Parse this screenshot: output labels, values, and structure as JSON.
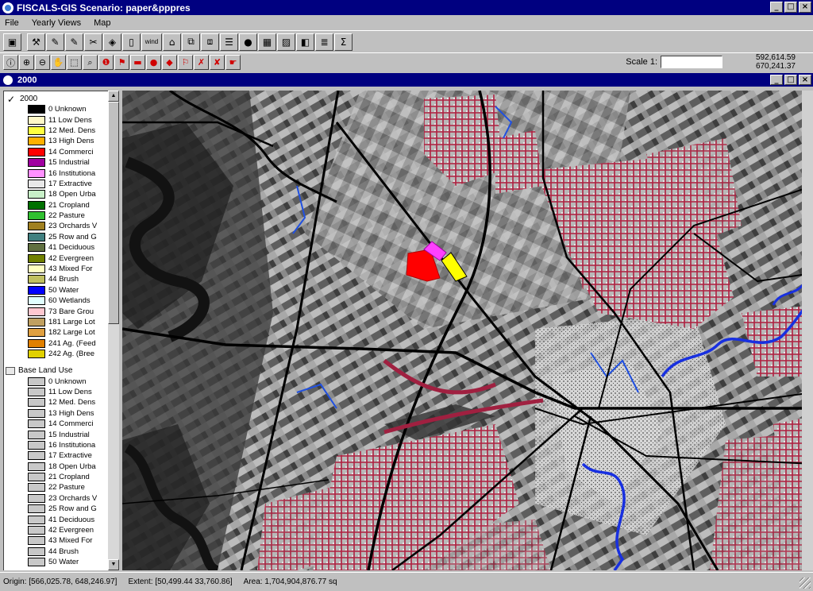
{
  "window": {
    "title": "FISCALS-GIS  Scenario: paper&pppres",
    "min": "_",
    "max": "□",
    "close": "×"
  },
  "menu": [
    "File",
    "Yearly Views",
    "Map"
  ],
  "toolbar1": [
    {
      "name": "save-icon",
      "glyph": "▣"
    },
    {
      "name": "hammer-icon",
      "glyph": "⚒"
    },
    {
      "name": "edit-down-icon",
      "glyph": "✎"
    },
    {
      "name": "edit-up-icon",
      "glyph": "✎"
    },
    {
      "name": "ruler-icon",
      "glyph": "✂"
    },
    {
      "name": "back-icon",
      "glyph": "◈"
    },
    {
      "name": "page-icon",
      "glyph": "▯"
    },
    {
      "name": "wind-icon",
      "glyph": "wind",
      "wide": true
    },
    {
      "name": "open-folder-icon",
      "glyph": "⌂"
    },
    {
      "name": "copy-icon",
      "glyph": "⧉"
    },
    {
      "name": "paste-icon",
      "glyph": "⧈"
    },
    {
      "name": "list-icon",
      "glyph": "☰"
    },
    {
      "name": "blob-icon",
      "glyph": "●"
    },
    {
      "name": "grid-icon",
      "glyph": "▦"
    },
    {
      "name": "hatch-icon",
      "glyph": "▨"
    },
    {
      "name": "shape-icon",
      "glyph": "◧"
    },
    {
      "name": "stack-icon",
      "glyph": "≣"
    },
    {
      "name": "sum-icon",
      "glyph": "Σ"
    }
  ],
  "toolbar2": [
    {
      "name": "info-icon",
      "glyph": "ⓘ"
    },
    {
      "name": "zoom-in-icon",
      "glyph": "⊕"
    },
    {
      "name": "zoom-out-icon",
      "glyph": "⊖"
    },
    {
      "name": "pan-hand-icon",
      "glyph": "✋"
    },
    {
      "name": "select-box-icon",
      "glyph": "⬚"
    },
    {
      "name": "zoom-select-icon",
      "glyph": "⌕"
    },
    {
      "name": "alert-icon",
      "glyph": "❶",
      "red": true
    },
    {
      "name": "flag-icon",
      "glyph": "⚑",
      "red": true
    },
    {
      "name": "rectangle-icon",
      "glyph": "▬",
      "red": true
    },
    {
      "name": "circle-icon",
      "glyph": "●",
      "red": true
    },
    {
      "name": "polygon-icon",
      "glyph": "◆",
      "red": true
    },
    {
      "name": "flag-edit-icon",
      "glyph": "⚐",
      "red": true
    },
    {
      "name": "delete-icon",
      "glyph": "✗",
      "red": true
    },
    {
      "name": "delete-all-icon",
      "glyph": "✘",
      "red": true
    },
    {
      "name": "hand-point-icon",
      "glyph": "☛",
      "red": true
    }
  ],
  "scale": {
    "label": "Scale 1:",
    "value": ""
  },
  "coords": {
    "x": "592,614.59",
    "y": "670,241.37"
  },
  "child": {
    "title": "2000",
    "min": "_",
    "max": "□",
    "close": "×"
  },
  "legend": {
    "group1": {
      "title": "2000",
      "check": "✓"
    },
    "items1": [
      {
        "label": "0 Unknown",
        "color": "#000000"
      },
      {
        "label": "11 Low Dens",
        "color": "#fff8c8"
      },
      {
        "label": "12 Med. Dens",
        "color": "#ffff40"
      },
      {
        "label": "13 High Dens",
        "color": "#ffb000"
      },
      {
        "label": "14 Commerci",
        "color": "#ff0000"
      },
      {
        "label": "15 Industrial",
        "color": "#a000a0"
      },
      {
        "label": "16 Institutiona",
        "color": "#ff90ff"
      },
      {
        "label": "17 Extractive",
        "color": "#e8e8e8"
      },
      {
        "label": "18 Open Urba",
        "color": "#c8f0c8"
      },
      {
        "label": "21 Cropland",
        "color": "#007000"
      },
      {
        "label": "22 Pasture",
        "color": "#30c030"
      },
      {
        "label": "23 Orchards V",
        "color": "#a08020"
      },
      {
        "label": "25 Row and G",
        "color": "#408080"
      },
      {
        "label": "41 Deciduous",
        "color": "#607040"
      },
      {
        "label": "42 Evergreen",
        "color": "#708000"
      },
      {
        "label": "43 Mixed For",
        "color": "#ffffc0"
      },
      {
        "label": "44 Brush",
        "color": "#c0c060"
      },
      {
        "label": "50 Water",
        "color": "#0000ff"
      },
      {
        "label": "60 Wetlands",
        "color": "#e0ffff"
      },
      {
        "label": "73 Bare Grou",
        "color": "#ffc8d0"
      },
      {
        "label": "181 Large Lot",
        "color": "#c0a060"
      },
      {
        "label": "182 Large Lot",
        "color": "#e0a040"
      },
      {
        "label": "241 Ag. (Feed",
        "color": "#e08000"
      },
      {
        "label": "242 Ag. (Bree",
        "color": "#e0d000"
      }
    ],
    "group2": {
      "title": "Base Land Use"
    },
    "items2": [
      {
        "label": "0 Unknown"
      },
      {
        "label": "11 Low Dens"
      },
      {
        "label": "12 Med. Dens"
      },
      {
        "label": "13 High Dens"
      },
      {
        "label": "14 Commerci"
      },
      {
        "label": "15 Industrial"
      },
      {
        "label": "16 Institutiona"
      },
      {
        "label": "17 Extractive"
      },
      {
        "label": "18 Open Urba"
      },
      {
        "label": "21 Cropland"
      },
      {
        "label": "22 Pasture"
      },
      {
        "label": "23 Orchards V"
      },
      {
        "label": "25 Row and G"
      },
      {
        "label": "41 Deciduous"
      },
      {
        "label": "42 Evergreen"
      },
      {
        "label": "43 Mixed For"
      },
      {
        "label": "44 Brush"
      },
      {
        "label": "50 Water"
      }
    ]
  },
  "status": {
    "origin": "Origin: [566,025.78, 648,246.97]",
    "extent": "Extent: [50,499.44  33,760.86]",
    "area": "Area: 1,704,904,876.77 sq"
  },
  "colors": {
    "titlebar": "#000080",
    "face": "#c0c0c0",
    "roads": "#000000",
    "urban": "#c02040",
    "water": "#1830e0"
  }
}
